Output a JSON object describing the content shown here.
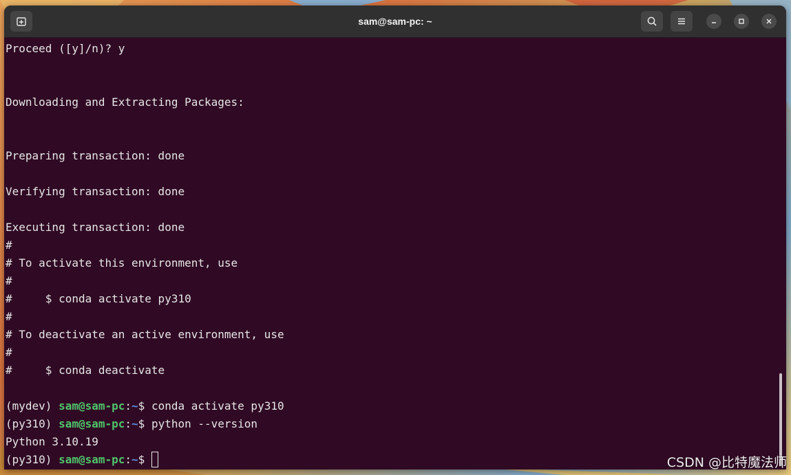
{
  "window": {
    "title": "sam@sam-pc: ~"
  },
  "titlebar": {
    "new_tab_icon": "new-tab-icon",
    "search_icon": "search-icon",
    "menu_icon": "hamburger-menu-icon",
    "minimize_icon": "minimize-icon",
    "maximize_icon": "maximize-icon",
    "close_icon": "close-icon"
  },
  "terminal": {
    "lines": [
      "Proceed ([y]/n)? y",
      "Downloading and Extracting Packages:",
      "Preparing transaction: done",
      "Verifying transaction: done",
      "Executing transaction: done",
      "#",
      "# To activate this environment, use",
      "#",
      "#     $ conda activate py310",
      "#",
      "# To deactivate an active environment, use",
      "#",
      "#     $ conda deactivate"
    ],
    "prompts": [
      {
        "env": "(mydev) ",
        "user": "sam@sam-pc",
        "sep": ":",
        "path": "~",
        "symbol": "$ ",
        "command": "conda activate py310"
      },
      {
        "env": "(py310) ",
        "user": "sam@sam-pc",
        "sep": ":",
        "path": "~",
        "symbol": "$ ",
        "command": "python --version"
      }
    ],
    "output": "Python 3.10.19",
    "current_prompt": {
      "env": "(py310) ",
      "user": "sam@sam-pc",
      "sep": ":",
      "path": "~",
      "symbol": "$ "
    }
  },
  "colors": {
    "terminal_bg": "#300a24",
    "user_green": "#4fc46b",
    "path_blue": "#5c8ee6",
    "titlebar_bg": "#303030"
  },
  "watermark": "CSDN @比特魔法师"
}
